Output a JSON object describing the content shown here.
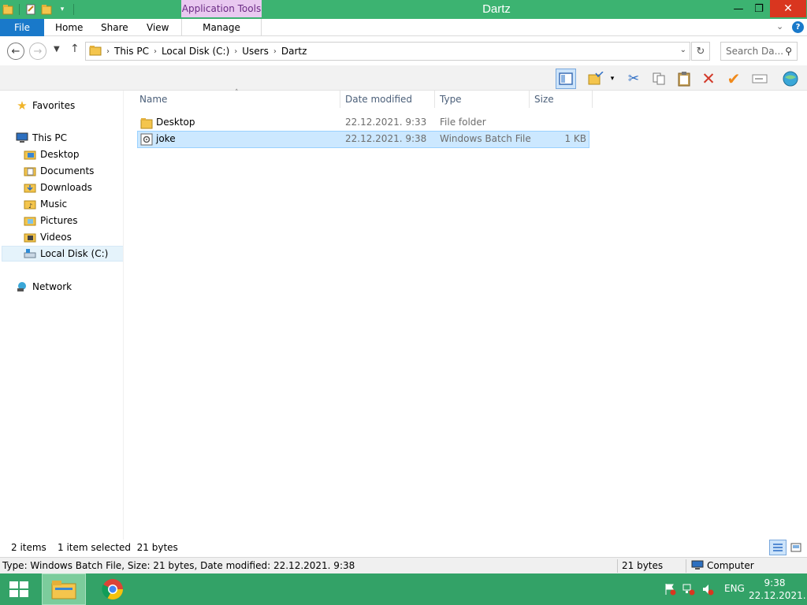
{
  "window": {
    "title": "Dartz",
    "contextual_tab_group": "Application Tools",
    "controls": {
      "minimize": "—",
      "maximize": "❐",
      "close": "✕"
    }
  },
  "ribbon": {
    "tabs": [
      {
        "label": "File"
      },
      {
        "label": "Home"
      },
      {
        "label": "Share"
      },
      {
        "label": "View"
      },
      {
        "label": "Manage"
      }
    ],
    "help": "?"
  },
  "address": {
    "crumbs": [
      "This PC",
      "Local Disk (C:)",
      "Users",
      "Dartz"
    ],
    "search_placeholder": "Search Da..."
  },
  "nav": {
    "favorites": "Favorites",
    "this_pc": "This PC",
    "items": [
      "Desktop",
      "Documents",
      "Downloads",
      "Music",
      "Pictures",
      "Videos",
      "Local Disk (C:)"
    ],
    "network": "Network"
  },
  "columns": {
    "name": "Name",
    "date": "Date modified",
    "type": "Type",
    "size": "Size"
  },
  "files": [
    {
      "name": "Desktop",
      "date": "22.12.2021. 9:33",
      "type": "File folder",
      "size": ""
    },
    {
      "name": "joke",
      "date": "22.12.2021. 9:38",
      "type": "Windows Batch File",
      "size": "1 KB"
    }
  ],
  "status": {
    "item_count": "2 items",
    "selection": "1 item selected  21 bytes"
  },
  "details": {
    "info": "Type: Windows Batch File, Size: 21 bytes, Date modified: 22.12.2021. 9:38",
    "size": "21 bytes",
    "location": "Computer"
  },
  "taskbar": {
    "lang": "ENG",
    "time": "9:38",
    "date": "22.12.2021."
  },
  "colors": {
    "accent": "#1979ca",
    "titlebar": "#3cb371",
    "taskbar": "#33a267",
    "selection": "#cce8ff"
  }
}
